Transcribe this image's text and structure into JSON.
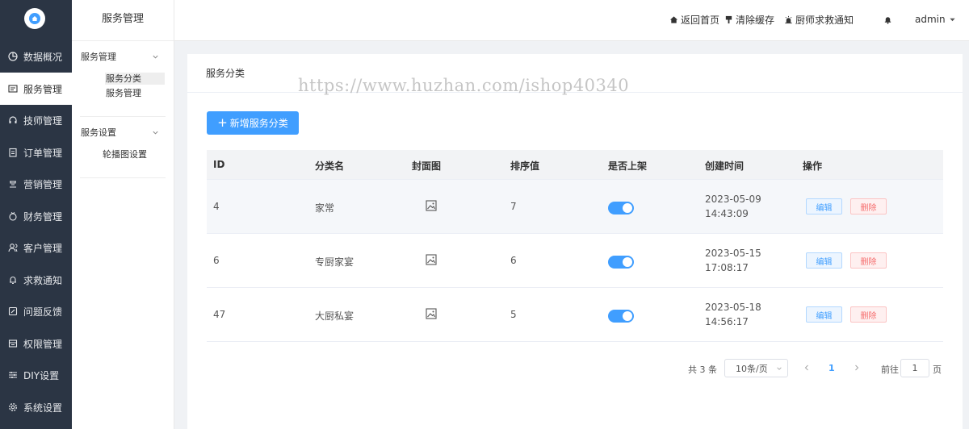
{
  "sidebar": {
    "items": [
      {
        "label": "数据概况",
        "icon": "pie-chart-icon"
      },
      {
        "label": "服务管理",
        "icon": "list-icon",
        "active": true
      },
      {
        "label": "技师管理",
        "icon": "headset-icon"
      },
      {
        "label": "订单管理",
        "icon": "clipboard-icon"
      },
      {
        "label": "营销管理",
        "icon": "marketing-icon"
      },
      {
        "label": "财务管理",
        "icon": "money-bag-icon"
      },
      {
        "label": "客户管理",
        "icon": "users-icon"
      },
      {
        "label": "求救通知",
        "icon": "bell-icon"
      },
      {
        "label": "问题反馈",
        "icon": "feedback-icon"
      },
      {
        "label": "权限管理",
        "icon": "permission-icon"
      },
      {
        "label": "DIY设置",
        "icon": "sliders-icon"
      },
      {
        "label": "系统设置",
        "icon": "gear-icon"
      }
    ]
  },
  "submenu": {
    "title": "服务管理",
    "groups": [
      {
        "label": "服务管理",
        "links": [
          "服务分类",
          "服务管理"
        ]
      },
      {
        "label": "服务设置",
        "links": [
          "轮播图设置"
        ]
      }
    ]
  },
  "header": {
    "home": "返回首页",
    "clear_cache": "清除缓存",
    "alarm": "厨师求救通知",
    "user": "admin"
  },
  "card": {
    "title": "服务分类",
    "add_button": "新增服务分类"
  },
  "watermark": "https://www.huzhan.com/ishop40340",
  "table": {
    "columns": [
      "ID",
      "分类名",
      "封面图",
      "排序值",
      "是否上架",
      "创建时间",
      "操作"
    ],
    "rows": [
      {
        "id": "4",
        "name": "家常",
        "sort": "7",
        "on_shelf": true,
        "date": "2023-05-09",
        "time": "14:43:09"
      },
      {
        "id": "6",
        "name": "专厨家宴",
        "sort": "6",
        "on_shelf": true,
        "date": "2023-05-15",
        "time": "17:08:17"
      },
      {
        "id": "47",
        "name": "大厨私宴",
        "sort": "5",
        "on_shelf": true,
        "date": "2023-05-18",
        "time": "14:56:17"
      }
    ],
    "edit_label": "编辑",
    "delete_label": "删除"
  },
  "pagination": {
    "total": "共 3 条",
    "page_size": "10条/页",
    "current": "1",
    "goto_prefix": "前往",
    "goto_value": "1",
    "goto_suffix": "页"
  },
  "colors": {
    "sidebar_bg": "#2b3544",
    "primary": "#409eff",
    "danger": "#f56c6c"
  }
}
